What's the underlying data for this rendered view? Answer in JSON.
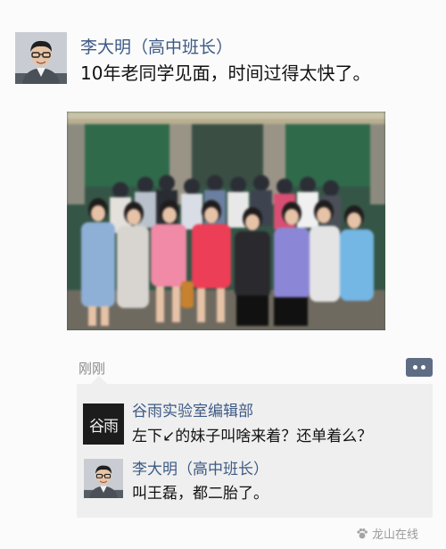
{
  "post": {
    "author_name": "李大明（高中班长）",
    "text": "10年老同学见面，时间过得太快了。",
    "timestamp": "刚刚"
  },
  "comments": [
    {
      "author_name": "谷雨实验室编辑部",
      "avatar_text": "谷雨",
      "text": "左下↙的妹子叫啥来着？还单着么？"
    },
    {
      "author_name": "李大明（高中班长）",
      "text": "叫王磊，都二胎了。"
    }
  ],
  "watermark": {
    "text": "龙山在线",
    "icon": "paw-icon"
  },
  "icons": {
    "more": "more-dots-icon"
  },
  "colors": {
    "name_link": "#3d5a85",
    "background": "#fbfbfb",
    "comment_bg": "#efefef",
    "more_button": "#5e6c84"
  }
}
